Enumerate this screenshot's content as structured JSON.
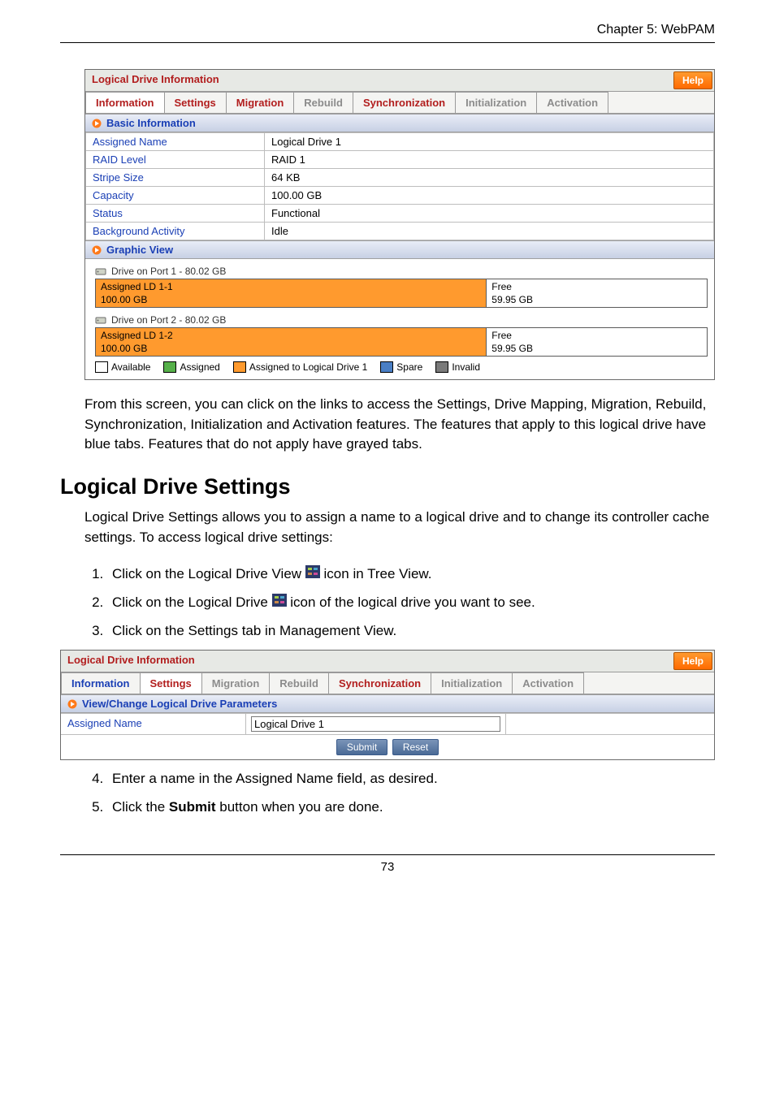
{
  "header": {
    "chapter": "Chapter 5: WebPAM"
  },
  "panel1": {
    "title": "Logical Drive Information",
    "help": "Help",
    "tabs": {
      "information": "Information",
      "settings": "Settings",
      "migration": "Migration",
      "rebuild": "Rebuild",
      "synchronization": "Synchronization",
      "initialization": "Initialization",
      "activation": "Activation"
    },
    "basic_section": "Basic Information",
    "rows": {
      "assigned_name_label": "Assigned Name",
      "assigned_name_value": "Logical Drive 1",
      "raid_level_label": "RAID Level",
      "raid_level_value": "RAID 1",
      "stripe_size_label": "Stripe Size",
      "stripe_size_value": "64 KB",
      "capacity_label": "Capacity",
      "capacity_value": "100.00 GB",
      "status_label": "Status",
      "status_value": "Functional",
      "bg_activity_label": "Background Activity",
      "bg_activity_value": "Idle"
    },
    "graphic_section": "Graphic View",
    "drives": [
      {
        "header": "Drive on Port 1 - 80.02 GB",
        "assigned_label": "Assigned LD 1-1",
        "assigned_size": "100.00 GB",
        "free_label": "Free",
        "free_size": "59.95 GB"
      },
      {
        "header": "Drive on Port 2 - 80.02 GB",
        "assigned_label": "Assigned LD 1-2",
        "assigned_size": "100.00 GB",
        "free_label": "Free",
        "free_size": "59.95 GB"
      }
    ],
    "legend": {
      "available": "Available",
      "assigned": "Assigned",
      "assigned_current": "Assigned to Logical Drive 1",
      "spare": "Spare",
      "invalid": "Invalid"
    }
  },
  "paragraph1": "From this screen, you can click on the links to access the Settings, Drive Mapping, Migration, Rebuild, Synchronization, Initialization and Activation features. The features that apply to this logical drive have blue tabs. Features that do not apply have grayed tabs.",
  "section_title": "Logical Drive Settings",
  "paragraph2": "Logical Drive Settings allows you to assign a name to a logical drive and to change its controller cache settings. To access logical drive settings:",
  "steps1": {
    "s1a": "Click on the Logical Drive View ",
    "s1b": " icon in Tree View.",
    "s2a": "Click on the Logical Drive ",
    "s2b": " icon of the logical drive you want to see.",
    "s3": "Click on the Settings tab in Management View."
  },
  "panel2": {
    "title": "Logical Drive Information",
    "help": "Help",
    "tabs": {
      "information": "Information",
      "settings": "Settings",
      "migration": "Migration",
      "rebuild": "Rebuild",
      "synchronization": "Synchronization",
      "initialization": "Initialization",
      "activation": "Activation"
    },
    "section": "View/Change Logical Drive Parameters",
    "assigned_name_label": "Assigned Name",
    "assigned_name_value": "Logical Drive 1",
    "submit": "Submit",
    "reset": "Reset"
  },
  "steps2": {
    "s4": "Enter a name in the Assigned Name field, as desired.",
    "s5a": "Click the ",
    "s5b": "Submit",
    "s5c": " button when you are done."
  },
  "footer": {
    "page": "73"
  }
}
